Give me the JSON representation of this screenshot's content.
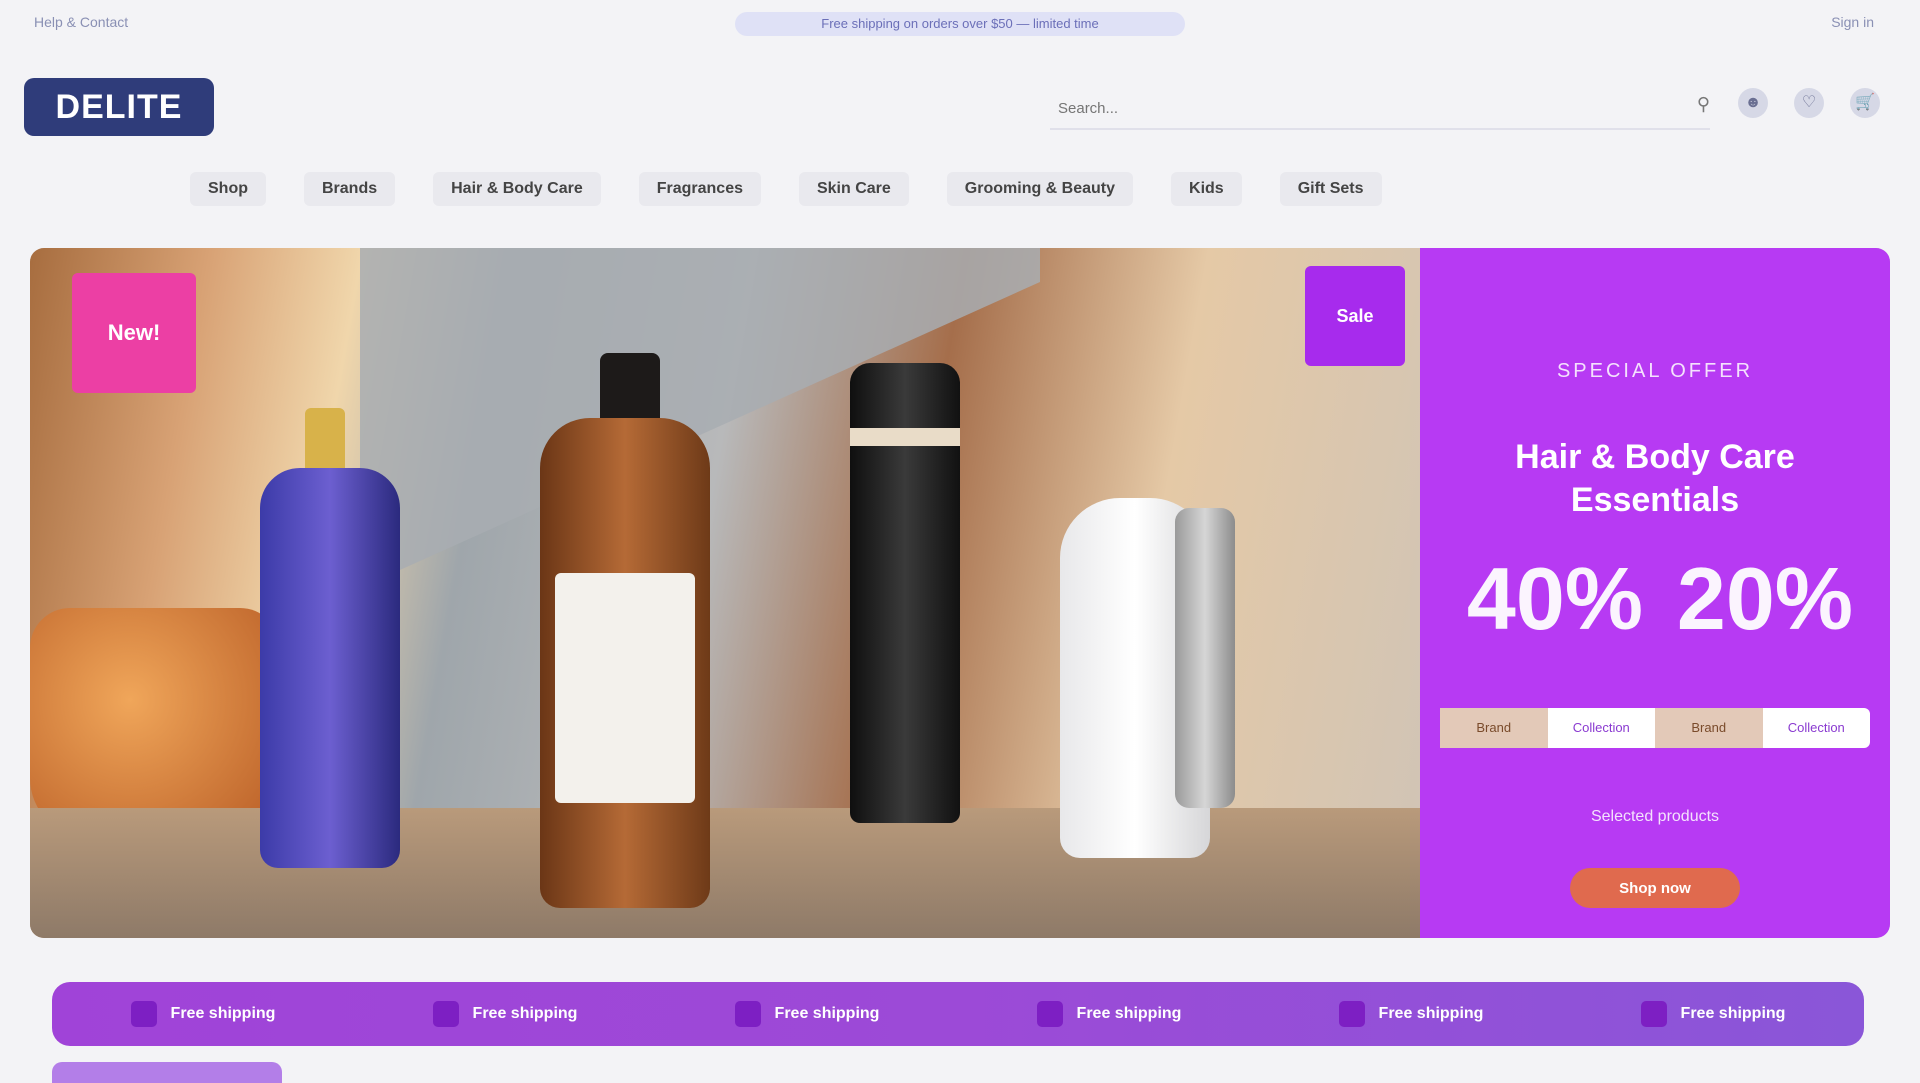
{
  "topbar": {
    "left_text": "Help & Contact",
    "promo_text": "Free shipping on orders over $50 — limited time",
    "right_text": "Sign in"
  },
  "header": {
    "logo_text": "DELITE",
    "search_placeholder": "Search..."
  },
  "nav": {
    "items": [
      "Shop",
      "Brands",
      "Hair & Body Care",
      "Fragrances",
      "Skin Care",
      "Grooming & Beauty",
      "Kids",
      "Gift Sets"
    ]
  },
  "hero": {
    "pink_badge": "New!",
    "purple_badge": "Sale",
    "panel": {
      "kicker": "SPECIAL OFFER",
      "headline": "Hair & Body Care Essentials",
      "pcts": [
        "40%",
        "20%"
      ],
      "strip": [
        "Brand",
        "Collection",
        "Brand",
        "Collection"
      ],
      "subtext": "Selected products",
      "cta": "Shop now"
    }
  },
  "ticker": {
    "items": [
      "Free shipping",
      "Free shipping",
      "Free shipping",
      "Free shipping",
      "Free shipping",
      "Free shipping"
    ]
  },
  "colors": {
    "panel": "#b73af3",
    "pink_badge": "#ec3fa4",
    "purple_badge": "#a72bed",
    "cta": "#e06a4e",
    "ticker": "#9c4ad7"
  }
}
